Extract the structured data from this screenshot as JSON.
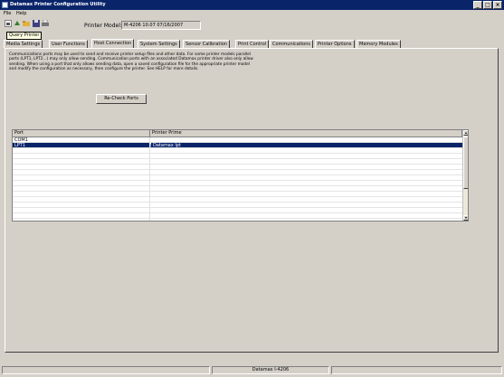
{
  "window": {
    "title": "Datamax Printer Configuration Utility",
    "min_glyph": "_",
    "max_glyph": "□",
    "close_glyph": "×"
  },
  "menu": [
    {
      "label": "File"
    },
    {
      "label": "Help"
    }
  ],
  "toolbar": {
    "tools": [
      "query-printer",
      "download",
      "open-file",
      "save-file",
      "print"
    ],
    "tooltip": "Query Printer"
  },
  "printer_model": {
    "label": "Printer Model:",
    "value": "M-4206 10.07 07/16/2007"
  },
  "tabs": [
    "Media Settings",
    "User Functions",
    "Host Connection",
    "System Settings",
    "Sensor Calibration",
    "Print Control",
    "Communications",
    "Printer Options",
    "Memory Modules"
  ],
  "active_tab": "Host Connection",
  "description": "Communications ports may be used to send and receive printer setup files and other data. For some printer models parallel ports (LPT1, LPT2...) may only allow sending. Communication ports with an associated Datamax printer driver also only allow sending. When using a port that only allows sending data, open a saved configuration file for the appropriate printer model and modify the configuration as necessary, then configure the printer. See HELP for more details.",
  "recheck_button": "Re-Check Ports",
  "ports_table": {
    "columns": [
      "Port",
      "Printer Prime"
    ],
    "rows": [
      {
        "port": "COM1",
        "printer": ""
      },
      {
        "port": "LPT1",
        "printer": "Datamax lpt"
      }
    ],
    "selected_index": 1
  },
  "status": {
    "panel_text": "Datamax I-4206"
  }
}
